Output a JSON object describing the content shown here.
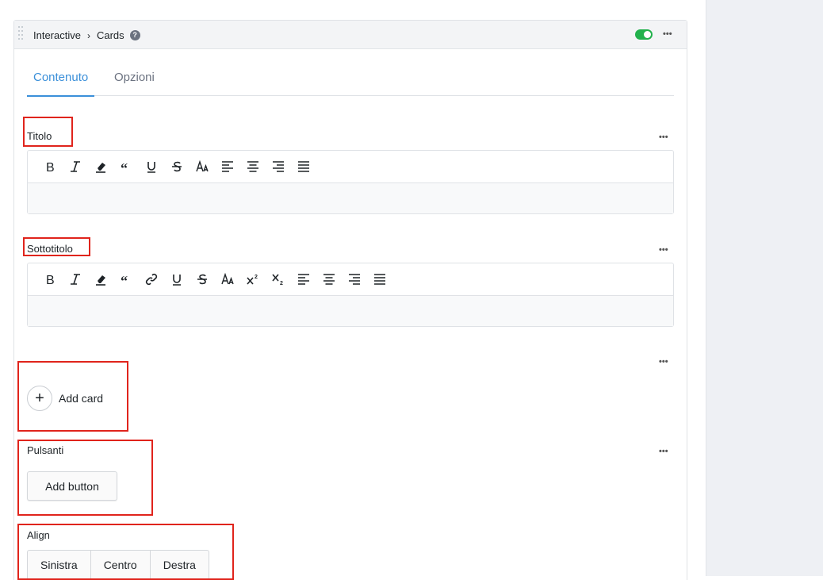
{
  "header": {
    "breadcrumb_parent": "Interactive",
    "breadcrumb_sep": "›",
    "breadcrumb_current": "Cards",
    "help_glyph": "?",
    "menu_glyph": "•••"
  },
  "tabs": [
    {
      "label": "Contenuto",
      "active": true
    },
    {
      "label": "Opzioni",
      "active": false
    }
  ],
  "fields": {
    "title_label": "Titolo",
    "subtitle_label": "Sottotitolo",
    "buttons_label": "Pulsanti",
    "align_label": "Align"
  },
  "actions": {
    "add_card": "Add card",
    "add_card_glyph": "+",
    "add_button": "Add button"
  },
  "align_options": [
    "Sinistra",
    "Centro",
    "Destra"
  ],
  "title_toolbar": [
    "bold",
    "italic",
    "eraser",
    "quote",
    "underline",
    "strikethrough",
    "font-size",
    "align-left",
    "align-center",
    "align-right",
    "align-justify"
  ],
  "subtitle_toolbar": [
    "bold",
    "italic",
    "eraser",
    "quote",
    "link",
    "underline",
    "strikethrough",
    "font-size",
    "superscript",
    "subscript",
    "align-left",
    "align-center",
    "align-right",
    "align-justify"
  ],
  "colors": {
    "accent": "#3a8fd9",
    "toggle_on": "#22b14c",
    "highlight": "#e0241c"
  }
}
